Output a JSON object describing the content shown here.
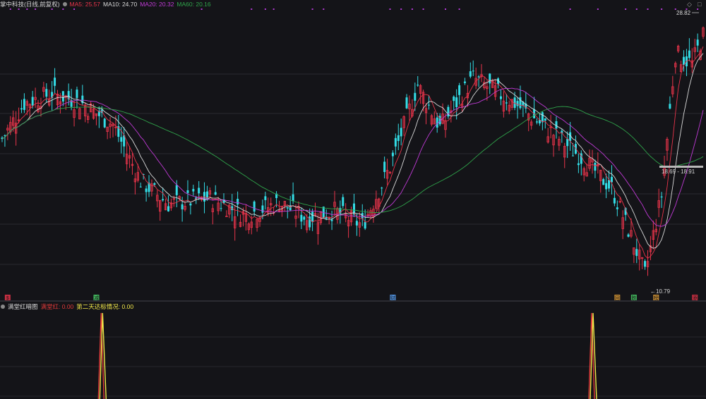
{
  "header": {
    "title": "掌中科技(日线,前复权)",
    "ma5": "MA5: 25.57",
    "ma10": "MA10: 24.70",
    "ma20": "MA20: 20.32",
    "ma60": "MA60: 20.16"
  },
  "controls": {
    "diamond": "◇",
    "box": "□"
  },
  "sub_header": {
    "title": "满堂红暗图",
    "v1": "满堂红: 0.00",
    "v2": "第二天达标情况: 0.00"
  },
  "colors": {
    "up": "#e8344a",
    "down": "#33dde6",
    "ma5": "#e8344a",
    "ma10": "#d9d9d9",
    "ma20": "#c03ad6",
    "ma60": "#2fa34a",
    "signal1": "#e23a3a",
    "signal2": "#f2e84a"
  },
  "chart_data": [
    {
      "type": "candlestick",
      "price_range": [
        10.0,
        30.0
      ],
      "annotations": {
        "high": "28.82",
        "low": "10.79",
        "crosshair_range": "18.69 - 18.91"
      },
      "markers": [
        {
          "label": "$",
          "color": "#e8344a"
        },
        {
          "label": "减",
          "color": "#4ad06a"
        },
        {
          "label": "财",
          "color": "#5aa6ff"
        },
        {
          "label": "回",
          "color": "#e8a23a"
        },
        {
          "label": "跌",
          "color": "#4ad06a"
        },
        {
          "label": "榜",
          "color": "#e8a23a"
        },
        {
          "label": "添",
          "color": "#e8344a"
        }
      ],
      "trend_points": [
        [
          0,
          21.0
        ],
        [
          8,
          23.5
        ],
        [
          18,
          24.2
        ],
        [
          28,
          23.6
        ],
        [
          40,
          22.0
        ],
        [
          50,
          18.0
        ],
        [
          60,
          16.4
        ],
        [
          75,
          16.8
        ],
        [
          88,
          15.6
        ],
        [
          100,
          16.5
        ],
        [
          110,
          15.4
        ],
        [
          120,
          15.9
        ],
        [
          130,
          14.9
        ],
        [
          140,
          19.0
        ],
        [
          150,
          24.8
        ],
        [
          158,
          21.8
        ],
        [
          170,
          25.3
        ],
        [
          185,
          23.5
        ],
        [
          200,
          21.2
        ],
        [
          210,
          19.5
        ],
        [
          220,
          17.5
        ],
        [
          228,
          13.6
        ],
        [
          232,
          11.4
        ],
        [
          238,
          17.0
        ],
        [
          243,
          27.0
        ],
        [
          249,
          26.3
        ],
        [
          253,
          28.3
        ]
      ]
    },
    {
      "type": "line",
      "name": "满堂红",
      "spikes": [
        {
          "index": 36,
          "value": 1.0
        },
        {
          "index": 213,
          "value": 1.0
        }
      ],
      "ylim": [
        0,
        1.0
      ]
    }
  ]
}
